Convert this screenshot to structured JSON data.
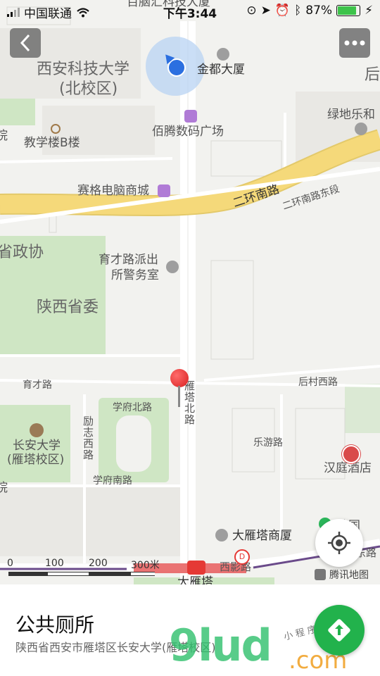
{
  "status": {
    "carrier": "中国联通",
    "time": "下午3:44",
    "battery": "87%"
  },
  "map": {
    "labels": {
      "top_cut": "百脑汇科技大厦",
      "xikeda": "西安科技大学",
      "xikeda_north": "(北校区)",
      "jindu": "金都大厦",
      "houxiang": "后",
      "baiteng": "佰腾数码广场",
      "lvdi": "绿地乐和",
      "jiaoxue": "教学楼B楼",
      "yuan": "院",
      "saige": "赛格电脑商城",
      "erhuan": "二环南路",
      "erhuan_east": "二环南路东段",
      "zhengxie": "省政协",
      "yucai_police1": "育才路派出",
      "yucai_police2": "所警务室",
      "shengwei": "陕西省委",
      "yucai_rd": "育才路",
      "yanta_north": "雁塔北路",
      "houcun": "后村西路",
      "xuefu_north": "学府北路",
      "lizhi": "励志西路",
      "changan_uni": "长安大学",
      "changan_campus": "(雁塔校区)",
      "leyou": "乐游路",
      "hanting": "汉庭酒店",
      "yuan2": "院",
      "xuefu_south": "学府南路",
      "dayanta_mall": "大雁塔商厦",
      "nana": "纳国",
      "xiying": "西影路",
      "dayanta": "大雁塔",
      "dongqu": "东路",
      "tencent": "腾讯地图"
    },
    "scale": [
      "0",
      "100",
      "200",
      "300米"
    ]
  },
  "place": {
    "name": "公共厕所",
    "address": "陕西省西安市雁塔区长安大学(雁塔校区)"
  },
  "watermark": {
    "brand": "9lud",
    "domain": ".com",
    "slogan": "小 程 序 商 店"
  },
  "colors": {
    "road_major": "#f5d97a",
    "green": "#cfe6c4",
    "accent": "#22b24c",
    "pin": "#e53935"
  },
  "icons": [
    "back-icon",
    "more-icon",
    "location-dot-icon",
    "locate-icon",
    "navigate-icon",
    "pin-icon"
  ]
}
